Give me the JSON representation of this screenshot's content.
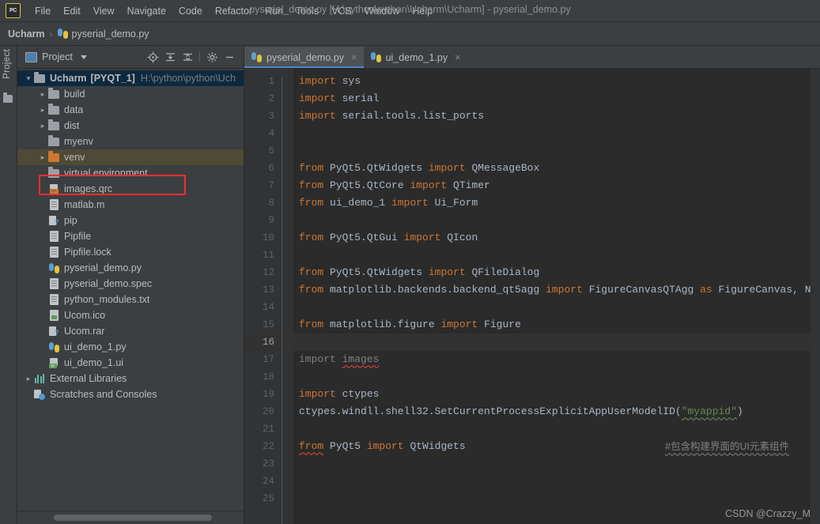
{
  "window": {
    "app_icon": "pycharm-logo-icon",
    "title": "pyserial_demo.py [H:\\python\\python\\Ucharm\\Ucharm] - pyserial_demo.py",
    "menu": [
      "File",
      "Edit",
      "View",
      "Navigate",
      "Code",
      "Refactor",
      "Run",
      "Tools",
      "VCS",
      "Window",
      "Help"
    ]
  },
  "breadcrumb": {
    "project": "Ucharm",
    "separator": "›",
    "file": "pyserial_demo.py"
  },
  "left_toolbar": {
    "label": "Project"
  },
  "project_panel": {
    "title": "Project",
    "tools": [
      {
        "name": "locate-target-icon",
        "title": "Select Opened File"
      },
      {
        "name": "expand-all-icon",
        "title": "Expand All"
      },
      {
        "name": "collapse-all-icon",
        "title": "Collapse All"
      },
      {
        "name": "gear-icon",
        "title": "Settings"
      },
      {
        "name": "minimize-icon",
        "title": "Hide"
      }
    ],
    "root": {
      "name": "Ucharm",
      "module": "[PYQT_1]",
      "path": "H:\\python\\python\\Uch",
      "expanded": true
    },
    "items": [
      {
        "label": "build",
        "icon": "folder-icon",
        "depth": 1,
        "arrow": "collapsed",
        "selected": false
      },
      {
        "label": "data",
        "icon": "folder-icon",
        "depth": 1,
        "arrow": "collapsed",
        "selected": false
      },
      {
        "label": "dist",
        "icon": "folder-icon",
        "depth": 1,
        "arrow": "collapsed",
        "selected": false
      },
      {
        "label": "myenv",
        "icon": "folder-icon",
        "depth": 1,
        "arrow": "none",
        "selected": false
      },
      {
        "label": "venv",
        "icon": "folder-orange-icon",
        "depth": 1,
        "arrow": "collapsed",
        "selected": true
      },
      {
        "label": "virtual environment",
        "icon": "folder-icon",
        "depth": 1,
        "arrow": "none",
        "selected": false
      },
      {
        "label": "images.qrc",
        "icon": "qrc-file-icon",
        "depth": 1,
        "arrow": "none",
        "selected": false,
        "highlighted": true
      },
      {
        "label": "matlab.m",
        "icon": "file-icon",
        "depth": 1,
        "arrow": "none",
        "selected": false
      },
      {
        "label": "pip",
        "icon": "rar-file-icon",
        "depth": 1,
        "arrow": "none",
        "selected": false
      },
      {
        "label": "Pipfile",
        "icon": "file-icon",
        "depth": 1,
        "arrow": "none",
        "selected": false
      },
      {
        "label": "Pipfile.lock",
        "icon": "file-icon",
        "depth": 1,
        "arrow": "none",
        "selected": false
      },
      {
        "label": "pyserial_demo.py",
        "icon": "python-file-icon",
        "depth": 1,
        "arrow": "none",
        "selected": false
      },
      {
        "label": "pyserial_demo.spec",
        "icon": "file-icon",
        "depth": 1,
        "arrow": "none",
        "selected": false
      },
      {
        "label": "python_modules.txt",
        "icon": "file-icon",
        "depth": 1,
        "arrow": "none",
        "selected": false
      },
      {
        "label": "Ucom.ico",
        "icon": "image-file-icon",
        "depth": 1,
        "arrow": "none",
        "selected": false
      },
      {
        "label": "Ucom.rar",
        "icon": "rar-file-icon",
        "depth": 1,
        "arrow": "none",
        "selected": false
      },
      {
        "label": "ui_demo_1.py",
        "icon": "python-file-icon",
        "depth": 1,
        "arrow": "none",
        "selected": false
      },
      {
        "label": "ui_demo_1.ui",
        "icon": "qt-ui-file-icon",
        "depth": 1,
        "arrow": "none",
        "selected": false
      },
      {
        "label": "External Libraries",
        "icon": "library-icon",
        "depth": 0,
        "arrow": "collapsed",
        "selected": false
      },
      {
        "label": "Scratches and Consoles",
        "icon": "scratches-icon",
        "depth": 0,
        "arrow": "none",
        "selected": false
      }
    ]
  },
  "editor": {
    "tabs": [
      {
        "label": "pyserial_demo.py",
        "icon": "python-file-icon",
        "active": true,
        "close": "×"
      },
      {
        "label": "ui_demo_1.py",
        "icon": "python-file-icon",
        "active": false,
        "close": "×"
      }
    ],
    "caret_line": 16,
    "line_numbers": [
      1,
      2,
      3,
      4,
      5,
      6,
      7,
      8,
      9,
      10,
      11,
      12,
      13,
      14,
      15,
      16,
      17,
      18,
      19,
      20,
      21,
      22,
      23,
      24,
      25
    ],
    "lines": [
      {
        "n": 1,
        "segments": [
          {
            "t": "import",
            "c": "kw"
          },
          {
            "t": " sys",
            "c": "id"
          }
        ],
        "fold": true
      },
      {
        "n": 2,
        "segments": [
          {
            "t": "import",
            "c": "kw"
          },
          {
            "t": " serial",
            "c": "id"
          }
        ]
      },
      {
        "n": 3,
        "segments": [
          {
            "t": "import",
            "c": "kw"
          },
          {
            "t": " serial.tools.list_ports",
            "c": "id"
          }
        ]
      },
      {
        "n": 4,
        "segments": []
      },
      {
        "n": 5,
        "segments": []
      },
      {
        "n": 6,
        "segments": [
          {
            "t": "from",
            "c": "kw"
          },
          {
            "t": " PyQt5.QtWidgets ",
            "c": "id"
          },
          {
            "t": "import",
            "c": "kw"
          },
          {
            "t": " QMessageBox",
            "c": "id"
          }
        ]
      },
      {
        "n": 7,
        "segments": [
          {
            "t": "from",
            "c": "kw"
          },
          {
            "t": " PyQt5.QtCore ",
            "c": "id"
          },
          {
            "t": "import",
            "c": "kw"
          },
          {
            "t": " QTimer",
            "c": "id"
          }
        ]
      },
      {
        "n": 8,
        "segments": [
          {
            "t": "from",
            "c": "kw"
          },
          {
            "t": " ui_demo_1 ",
            "c": "id"
          },
          {
            "t": "import",
            "c": "kw"
          },
          {
            "t": " Ui_Form",
            "c": "id"
          }
        ]
      },
      {
        "n": 9,
        "segments": []
      },
      {
        "n": 10,
        "segments": [
          {
            "t": "from",
            "c": "kw"
          },
          {
            "t": " PyQt5.QtGui ",
            "c": "id"
          },
          {
            "t": "import",
            "c": "kw"
          },
          {
            "t": " QIcon",
            "c": "id"
          }
        ]
      },
      {
        "n": 11,
        "segments": []
      },
      {
        "n": 12,
        "segments": [
          {
            "t": "from",
            "c": "kw"
          },
          {
            "t": " PyQt5.QtWidgets ",
            "c": "id"
          },
          {
            "t": "import",
            "c": "kw"
          },
          {
            "t": " QFileDialog",
            "c": "id"
          }
        ]
      },
      {
        "n": 13,
        "segments": [
          {
            "t": "from",
            "c": "kw"
          },
          {
            "t": " matplotlib.backends.backend_qt5agg ",
            "c": "id"
          },
          {
            "t": "import",
            "c": "kw"
          },
          {
            "t": " FigureCanvasQTAgg ",
            "c": "id"
          },
          {
            "t": "as",
            "c": "kw"
          },
          {
            "t": " FigureCanvas, N",
            "c": "id"
          }
        ]
      },
      {
        "n": 14,
        "segments": []
      },
      {
        "n": 15,
        "segments": [
          {
            "t": "from",
            "c": "kw"
          },
          {
            "t": " matplotlib.figure ",
            "c": "id"
          },
          {
            "t": "import",
            "c": "kw"
          },
          {
            "t": " Figure",
            "c": "id"
          }
        ]
      },
      {
        "n": 16,
        "segments": [],
        "current": true
      },
      {
        "n": 17,
        "segments": [
          {
            "t": "import",
            "c": "dim"
          },
          {
            "t": " ",
            "c": "dim"
          },
          {
            "t": "images",
            "c": "dim sq"
          }
        ]
      },
      {
        "n": 18,
        "segments": []
      },
      {
        "n": 19,
        "segments": [
          {
            "t": "import",
            "c": "kw"
          },
          {
            "t": " ctypes",
            "c": "id"
          }
        ],
        "fold": true
      },
      {
        "n": 20,
        "segments": [
          {
            "t": "ctypes.windll.shell32.SetCurrentProcessExplicitAppUserModelID(",
            "c": "id"
          },
          {
            "t": "\"myappid\"",
            "c": "str sq-green"
          },
          {
            "t": ")",
            "c": "id"
          }
        ]
      },
      {
        "n": 21,
        "segments": []
      },
      {
        "n": 22,
        "segments": [
          {
            "t": "from",
            "c": "kw sq"
          },
          {
            "t": " PyQt5 ",
            "c": "id"
          },
          {
            "t": "import",
            "c": "kw"
          },
          {
            "t": " QtWidgets",
            "c": "id"
          }
        ],
        "comment": "#包含构建界面的UI元素组件"
      },
      {
        "n": 23,
        "segments": []
      },
      {
        "n": 24,
        "segments": []
      },
      {
        "n": 25,
        "segments": []
      }
    ]
  },
  "watermark": "CSDN @Crazzy_M",
  "colors": {
    "keyword": "#CC7832",
    "identifier": "#A9B7C6",
    "string": "#6A8759",
    "comment": "#808080",
    "editor_bg": "#2B2B2B",
    "panel_bg": "#3C3F41",
    "selection_blue": "#0D293E",
    "selection_olive": "#4E4A36",
    "annotation_red": "#F03030",
    "tab_accent": "#4A88C7"
  }
}
